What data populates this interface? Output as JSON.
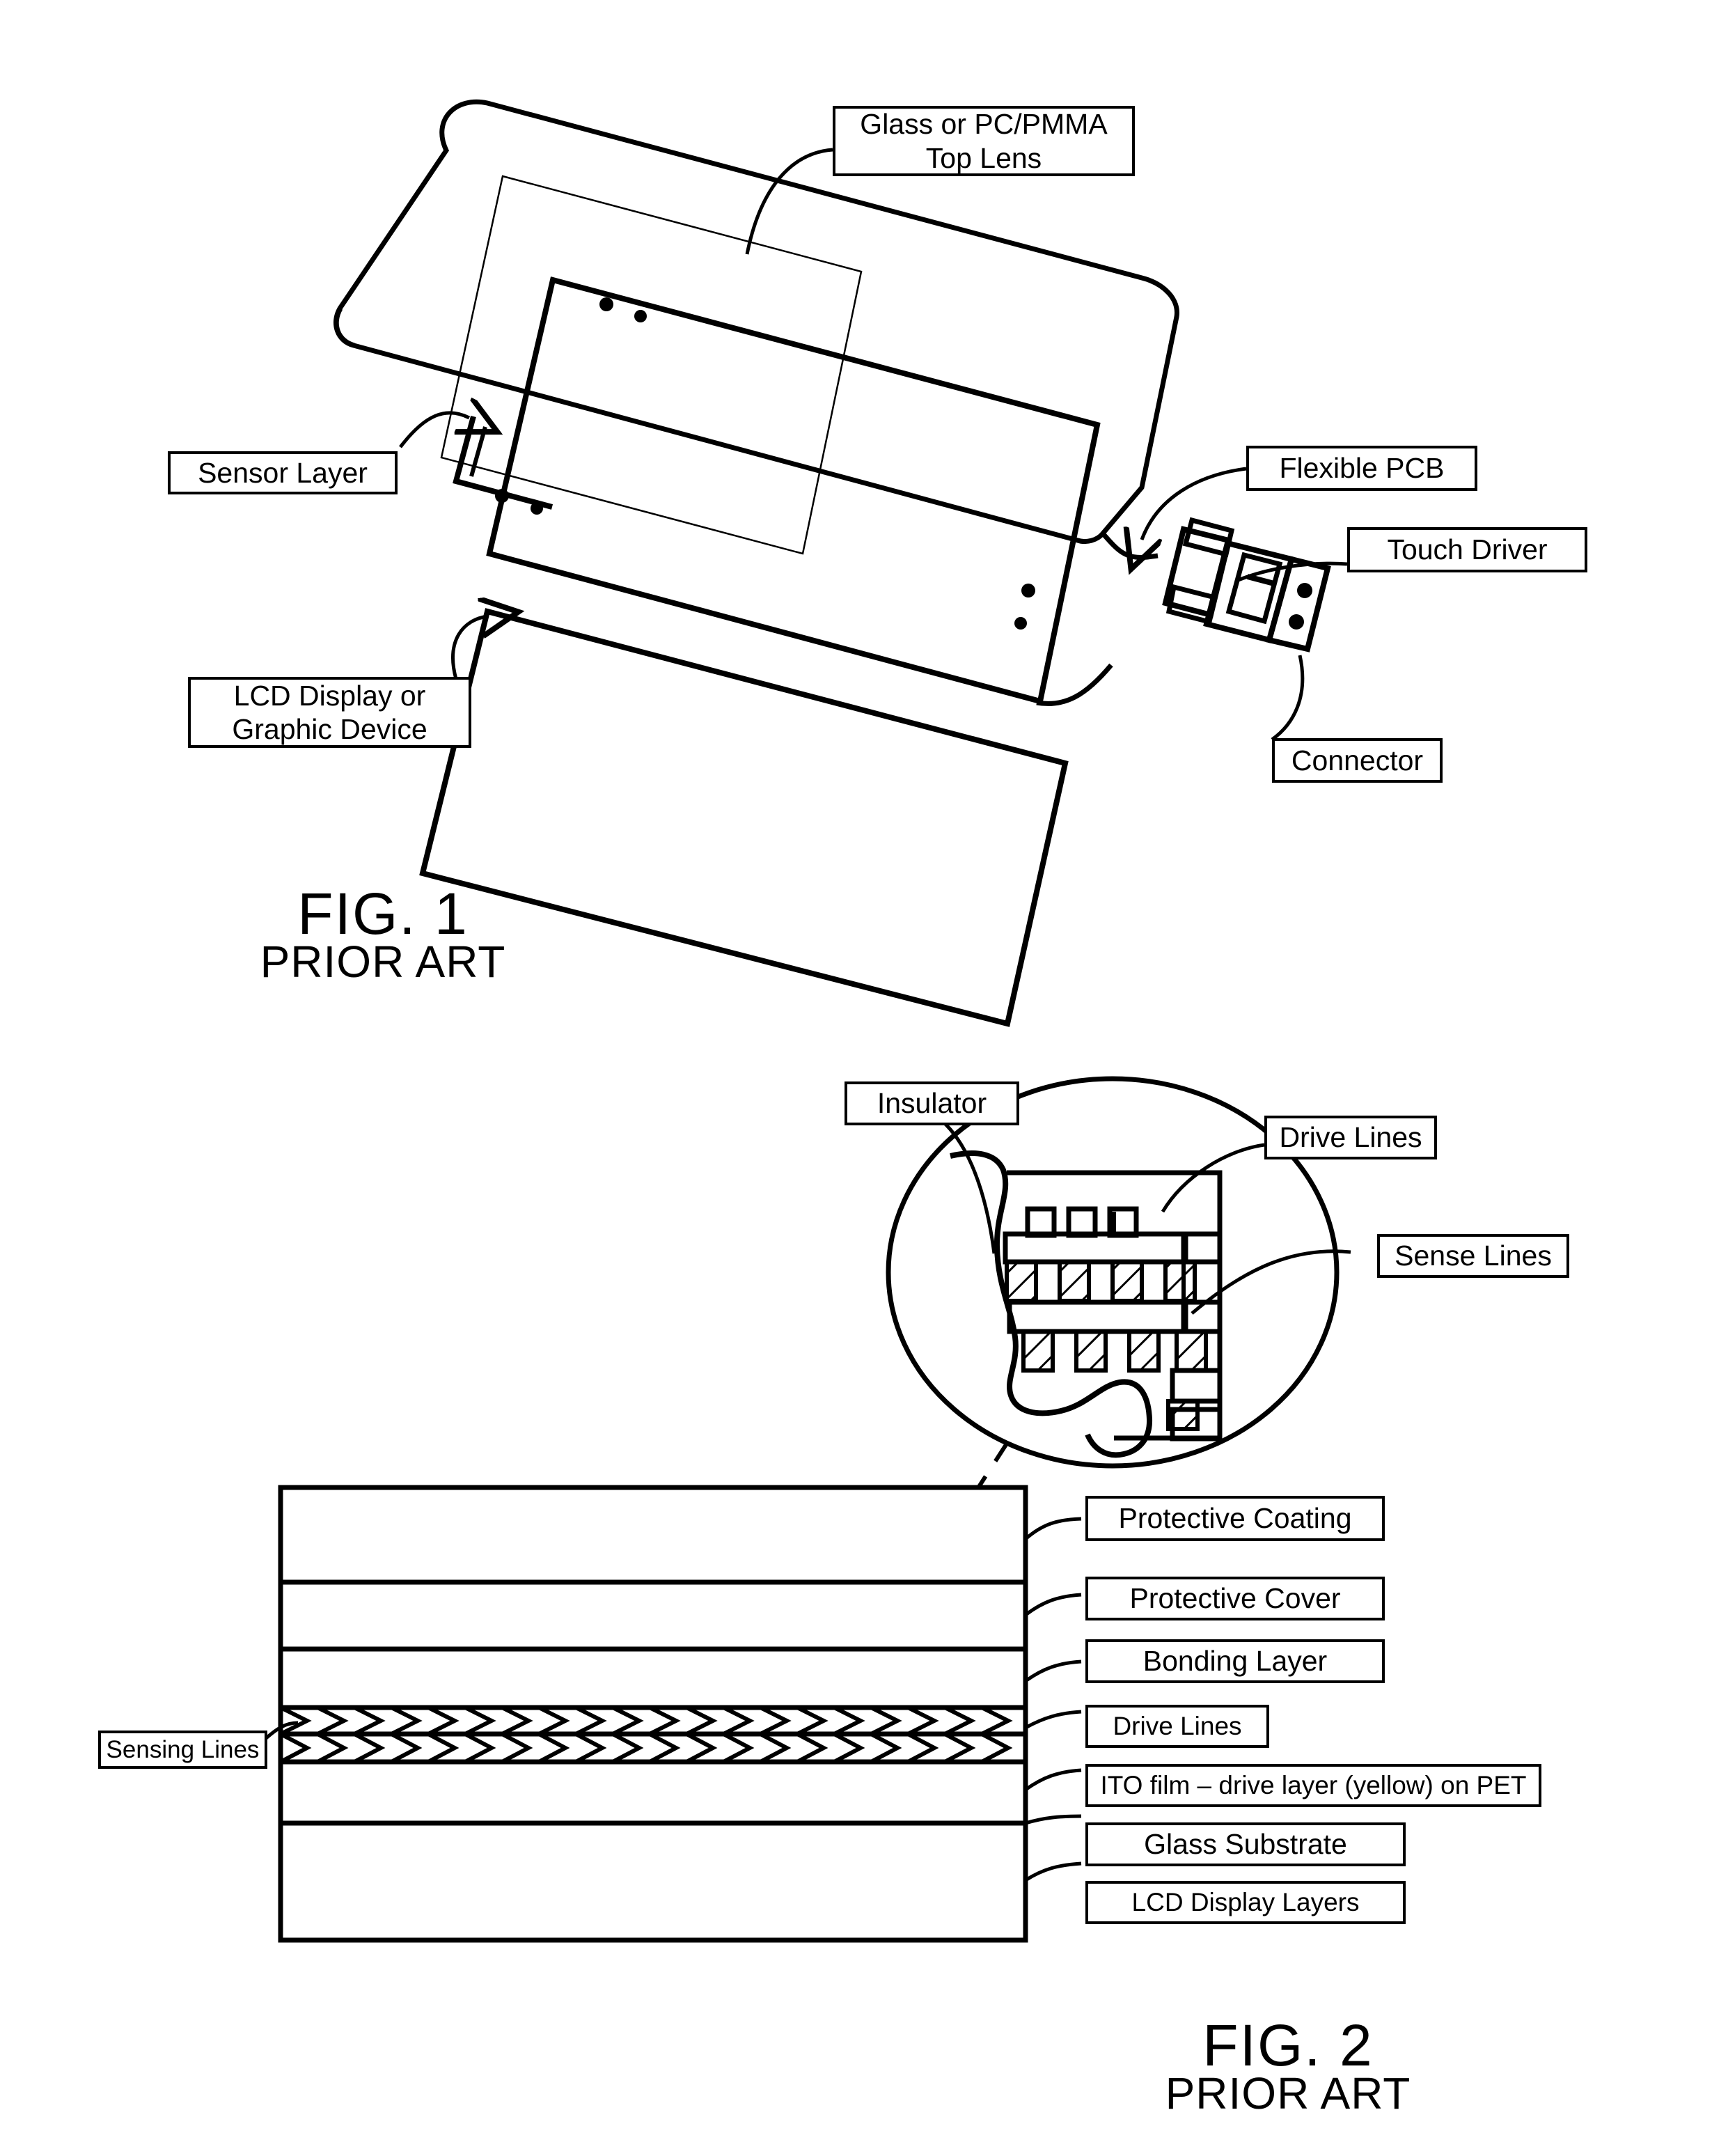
{
  "document": {
    "type": "patent-drawing",
    "sheet_background": "#ffffff",
    "ink_color": "#000000"
  },
  "figures": [
    {
      "id": "fig1",
      "caption_number": "FIG. 1",
      "caption_note": "PRIOR ART",
      "subject": "Exploded perspective view of a prior-art capacitive touch screen assembly",
      "labels": [
        {
          "key": "top_lens",
          "text": "Glass or PC/PMMA\nTop Lens"
        },
        {
          "key": "sensor",
          "text": "Sensor Layer"
        },
        {
          "key": "lcd",
          "text": "LCD Display or\nGraphic Device"
        },
        {
          "key": "flex_pcb",
          "text": "Flexible PCB"
        },
        {
          "key": "touch_driver",
          "text": "Touch Driver"
        },
        {
          "key": "connector",
          "text": "Connector"
        }
      ]
    },
    {
      "id": "fig2",
      "caption_number": "FIG. 2",
      "caption_note": "PRIOR ART",
      "subject": "Cross-sectional layer stack of a prior-art touch sensor with magnified detail callout",
      "callout_labels": [
        {
          "key": "insulator",
          "text": "Insulator"
        },
        {
          "key": "drive_lines",
          "text": "Drive Lines"
        },
        {
          "key": "sense_lines",
          "text": "Sense Lines"
        }
      ],
      "stack_labels": [
        {
          "key": "protective_coating",
          "text": "Protective Coating"
        },
        {
          "key": "protective_cover",
          "text": "Protective Cover"
        },
        {
          "key": "bonding_layer",
          "text": "Bonding Layer"
        },
        {
          "key": "drive_lines",
          "text": "Drive Lines"
        },
        {
          "key": "ito_film",
          "text": "ITO film – drive layer (yellow) on PET"
        },
        {
          "key": "glass_substrate",
          "text": "Glass Substrate"
        },
        {
          "key": "lcd_display_layers",
          "text": "LCD Display Layers"
        }
      ],
      "left_label": {
        "key": "sensing_lines",
        "text": "Sensing Lines"
      },
      "stack_order_top_to_bottom": [
        "Protective Coating",
        "Protective Cover",
        "Bonding Layer",
        "Drive Lines",
        "ITO film – drive layer (yellow) on PET",
        "Glass Substrate",
        "LCD Display Layers"
      ]
    }
  ]
}
